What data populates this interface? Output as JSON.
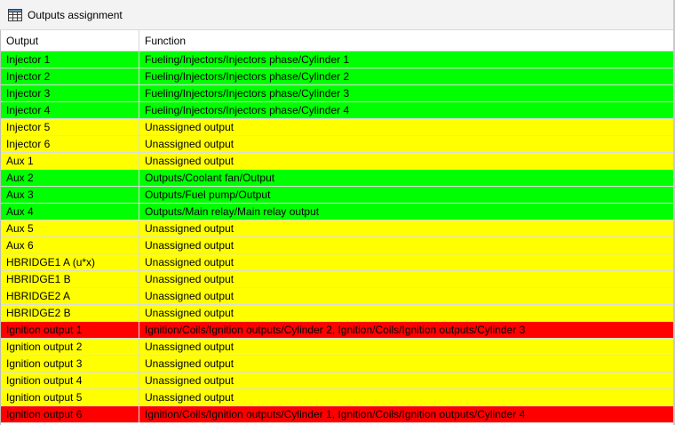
{
  "window": {
    "title": "Outputs assignment",
    "icon": "table-icon"
  },
  "colors": {
    "assigned": "#00ff00",
    "unassigned": "#ffff00",
    "conflict": "#ff0000"
  },
  "table": {
    "columns": [
      "Output",
      "Function"
    ],
    "rows": [
      {
        "output": "Injector 1",
        "function": "Fueling/Injectors/Injectors phase/Cylinder 1",
        "status": "assigned"
      },
      {
        "output": "Injector 2",
        "function": "Fueling/Injectors/Injectors phase/Cylinder 2",
        "status": "assigned"
      },
      {
        "output": "Injector 3",
        "function": "Fueling/Injectors/Injectors phase/Cylinder 3",
        "status": "assigned"
      },
      {
        "output": "Injector 4",
        "function": "Fueling/Injectors/Injectors phase/Cylinder 4",
        "status": "assigned"
      },
      {
        "output": "Injector 5",
        "function": "Unassigned output",
        "status": "unassigned"
      },
      {
        "output": "Injector 6",
        "function": "Unassigned output",
        "status": "unassigned"
      },
      {
        "output": "Aux 1",
        "function": "Unassigned output",
        "status": "unassigned"
      },
      {
        "output": "Aux 2",
        "function": "Outputs/Coolant fan/Output",
        "status": "assigned"
      },
      {
        "output": "Aux 3",
        "function": "Outputs/Fuel pump/Output",
        "status": "assigned"
      },
      {
        "output": "Aux 4",
        "function": "Outputs/Main relay/Main relay output",
        "status": "assigned"
      },
      {
        "output": "Aux 5",
        "function": "Unassigned output",
        "status": "unassigned"
      },
      {
        "output": "Aux 6",
        "function": "Unassigned output",
        "status": "unassigned"
      },
      {
        "output": "HBRIDGE1 A (u*x)",
        "function": "Unassigned output",
        "status": "unassigned"
      },
      {
        "output": "HBRIDGE1 B",
        "function": "Unassigned output",
        "status": "unassigned"
      },
      {
        "output": "HBRIDGE2 A",
        "function": "Unassigned output",
        "status": "unassigned"
      },
      {
        "output": "HBRIDGE2 B",
        "function": "Unassigned output",
        "status": "unassigned"
      },
      {
        "output": "Ignition output 1",
        "function": "Ignition/Coils/Ignition outputs/Cylinder 2, Ignition/Coils/Ignition outputs/Cylinder 3",
        "status": "conflict"
      },
      {
        "output": "Ignition output 2",
        "function": "Unassigned output",
        "status": "unassigned"
      },
      {
        "output": "Ignition output 3",
        "function": "Unassigned output",
        "status": "unassigned"
      },
      {
        "output": "Ignition output 4",
        "function": "Unassigned output",
        "status": "unassigned"
      },
      {
        "output": "Ignition output 5",
        "function": "Unassigned output",
        "status": "unassigned"
      },
      {
        "output": "Ignition output 6",
        "function": "Ignition/Coils/Ignition outputs/Cylinder 1, Ignition/Coils/Ignition outputs/Cylinder 4",
        "status": "conflict"
      }
    ]
  }
}
